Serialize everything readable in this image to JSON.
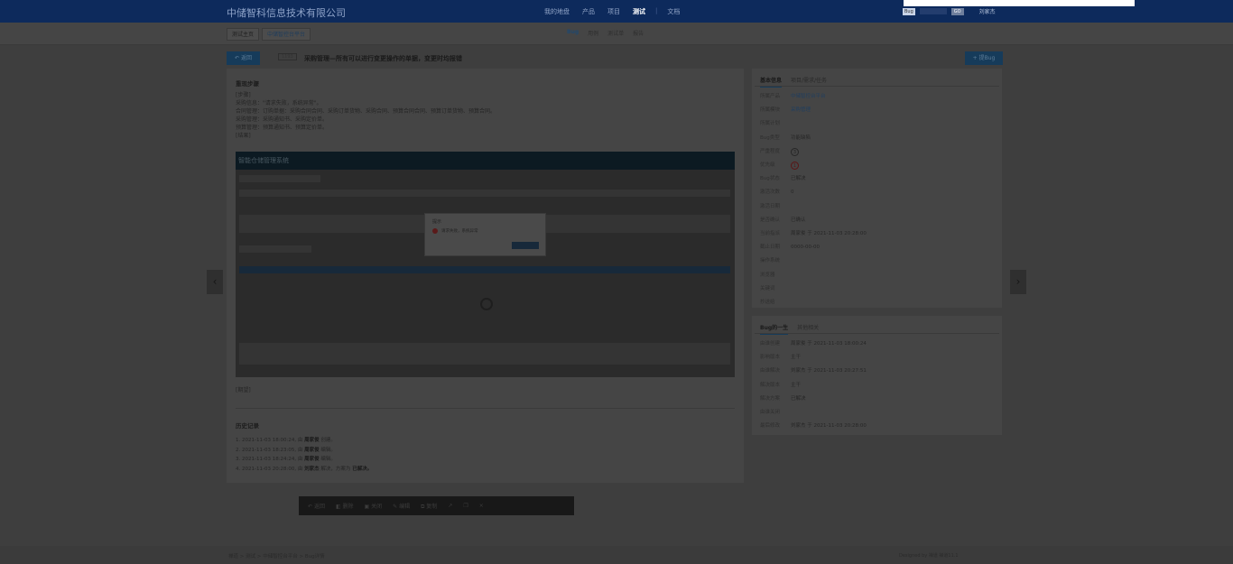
{
  "brand": "中储智科信息技术有限公司",
  "main_nav": [
    "我的地盘",
    "产品",
    "项目",
    "测试",
    "文档"
  ],
  "main_nav_active": "测试",
  "user": {
    "select": "Bug",
    "search_button": "GO",
    "name": "刘家杰"
  },
  "subbar": {
    "home": "测试主页",
    "product": "中储智控台平台",
    "tabs": [
      "Bug",
      "用例",
      "测试单",
      "报告"
    ],
    "active_tab": "Bug"
  },
  "bug": {
    "back_label": "返回",
    "id": "1193",
    "title": "采购管理—所有可以进行变更操作的单据，变更时均报错",
    "new_bug_label": "+ 提Bug"
  },
  "steps": {
    "heading": "重现步骤",
    "lines": [
      "[步骤]",
      "采购信息：\"请求失败，系统异常\"。",
      "合同管理：订购单据：采购合同合同、采购订单货物、采购合同、预算合同合同、预算订单货物、预算合同。",
      "采购管理：采购通知书、采购定价单。",
      "预算管理：预算通知书、预算定价单。",
      "[结果]"
    ],
    "screen_title": "智能仓储管理系统",
    "dialog_title": "提示",
    "dialog_message": "请求失败，系统异常",
    "dialog_ok": "确定",
    "result_label": "[期望]"
  },
  "history": {
    "heading": "历史记录",
    "entries": [
      {
        "time": "1. 2021-11-03 18:00:24, 由",
        "user": "周家俊",
        "action": "创建。"
      },
      {
        "time": "2. 2021-11-03 18:23:05, 由",
        "user": "周家俊",
        "action": "编辑。"
      },
      {
        "time": "3. 2021-11-03 18:24:24, 由",
        "user": "周家俊",
        "action": "编辑。"
      },
      {
        "time": "4. 2021-11-03 20:28:00, 由",
        "user": "刘家杰",
        "action": "解决，方案为",
        "extra": "已解决。"
      }
    ]
  },
  "basic_info": {
    "tabs": [
      "基本信息",
      "项目/需求/任务"
    ],
    "rows": [
      {
        "k": "所属产品",
        "v": "中储智控台平台",
        "type": "link"
      },
      {
        "k": "所属模块",
        "v": "采购管理",
        "type": "link"
      },
      {
        "k": "所属计划",
        "v": ""
      },
      {
        "k": "Bug类型",
        "v": "功能缺陷"
      },
      {
        "k": "严重程度",
        "v": "3",
        "type": "badge"
      },
      {
        "k": "优先级",
        "v": "1",
        "type": "badge-red"
      },
      {
        "k": "Bug状态",
        "v": "已解决"
      },
      {
        "k": "激活次数",
        "v": "0"
      },
      {
        "k": "激活日期",
        "v": ""
      },
      {
        "k": "是否确认",
        "v": "已确认"
      },
      {
        "k": "当前指派",
        "v": "周家俊 于 2021-11-03 20:28:00"
      },
      {
        "k": "截止日期",
        "v": "0000-00-00"
      },
      {
        "k": "操作系统",
        "v": ""
      },
      {
        "k": "浏览器",
        "v": ""
      },
      {
        "k": "关键词",
        "v": ""
      },
      {
        "k": "抄送给",
        "v": ""
      }
    ]
  },
  "lifecycle": {
    "tabs": [
      "Bug的一生",
      "其他相关"
    ],
    "rows": [
      {
        "k": "由谁创建",
        "v": "周家俊 于 2021-11-03 18:00:24"
      },
      {
        "k": "影响版本",
        "v": "主干"
      },
      {
        "k": "由谁解决",
        "v": "刘家杰 于 2021-11-03 20:27:51"
      },
      {
        "k": "解决版本",
        "v": "主干"
      },
      {
        "k": "解决方案",
        "v": "已解决"
      },
      {
        "k": "由谁关闭",
        "v": ""
      },
      {
        "k": "最后修改",
        "v": "刘家杰 于 2021-11-03 20:28:00"
      }
    ]
  },
  "toolbar": [
    "返回",
    "删除",
    "关闭",
    "编辑",
    "复制",
    "",
    "",
    "×"
  ],
  "footer": {
    "breadcrumb": "禅道 > 测试 > 中储智控台平台 > Bug详情",
    "right": "Designed by 禅道  禅道11.1"
  }
}
